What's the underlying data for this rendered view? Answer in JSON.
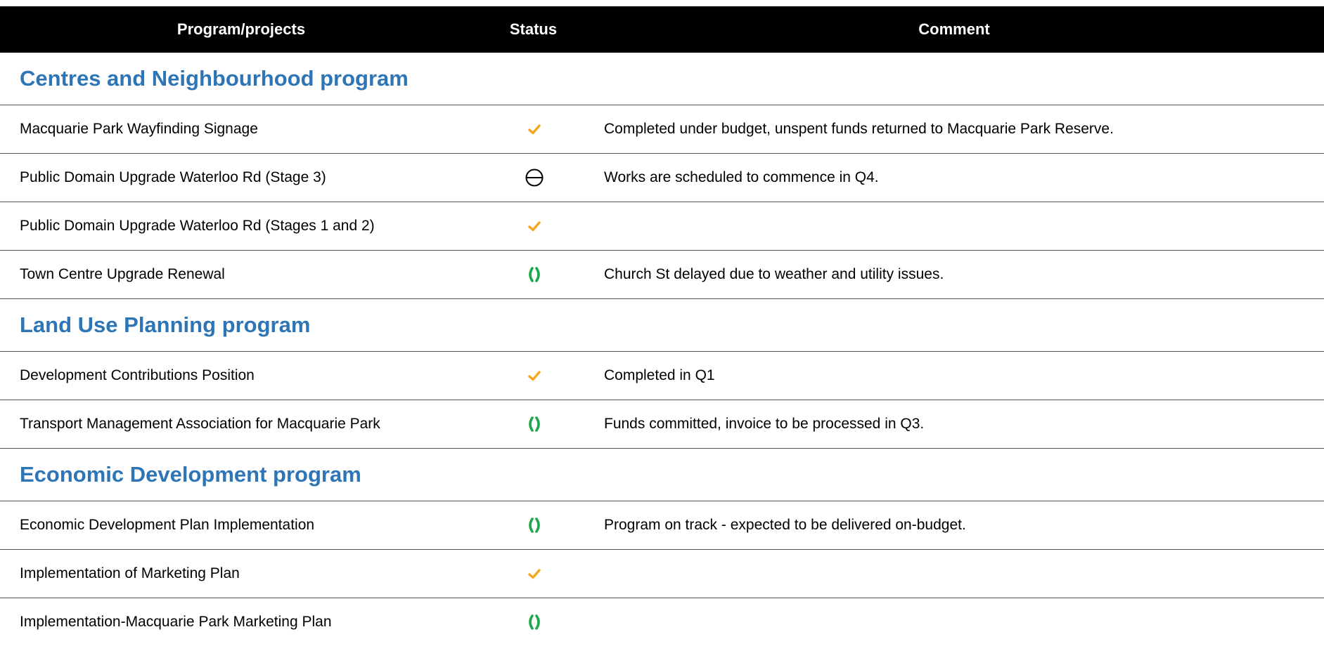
{
  "colors": {
    "header_bg": "#000000",
    "header_text": "#ffffff",
    "section_title": "#2e75b6",
    "completed": "#f5a623",
    "on_track": "#1aa84a",
    "not_started": "#000000"
  },
  "header": {
    "program": "Program/projects",
    "status": "Status",
    "comment": "Comment"
  },
  "sections": [
    {
      "title": "Centres and Neighbourhood program",
      "rows": [
        {
          "name": "Macquarie Park Wayfinding  Signage",
          "status_icon": "check-icon",
          "comment": "Completed under budget, unspent funds returned to Macquarie Park Reserve."
        },
        {
          "name": "Public Domain Upgrade Waterloo Rd (Stage 3)",
          "status_icon": "not-started-icon",
          "comment": "Works are scheduled to commence in Q4."
        },
        {
          "name": "Public Domain Upgrade Waterloo Rd (Stages 1 and 2)",
          "status_icon": "check-icon",
          "comment": ""
        },
        {
          "name": "Town Centre Upgrade Renewal",
          "status_icon": "on-track-icon",
          "comment": "Church St delayed due to weather and utility issues."
        }
      ]
    },
    {
      "title": "Land Use Planning program",
      "rows": [
        {
          "name": "Development Contributions Position",
          "status_icon": "check-icon",
          "comment": "Completed in Q1"
        },
        {
          "name": "Transport Management  Association for Macquarie Park",
          "status_icon": "on-track-icon",
          "comment": "Funds committed, invoice to be processed in Q3."
        }
      ]
    },
    {
      "title": "Economic Development program",
      "rows": [
        {
          "name": "Economic Development Plan Implementation",
          "status_icon": "on-track-icon",
          "comment": "Program on track - expected to be delivered on-budget."
        },
        {
          "name": "Implementation of Marketing Plan",
          "status_icon": "check-icon",
          "comment": ""
        },
        {
          "name": "Implementation-Macquarie Park Marketing Plan",
          "status_icon": "on-track-icon",
          "comment": ""
        }
      ]
    }
  ]
}
